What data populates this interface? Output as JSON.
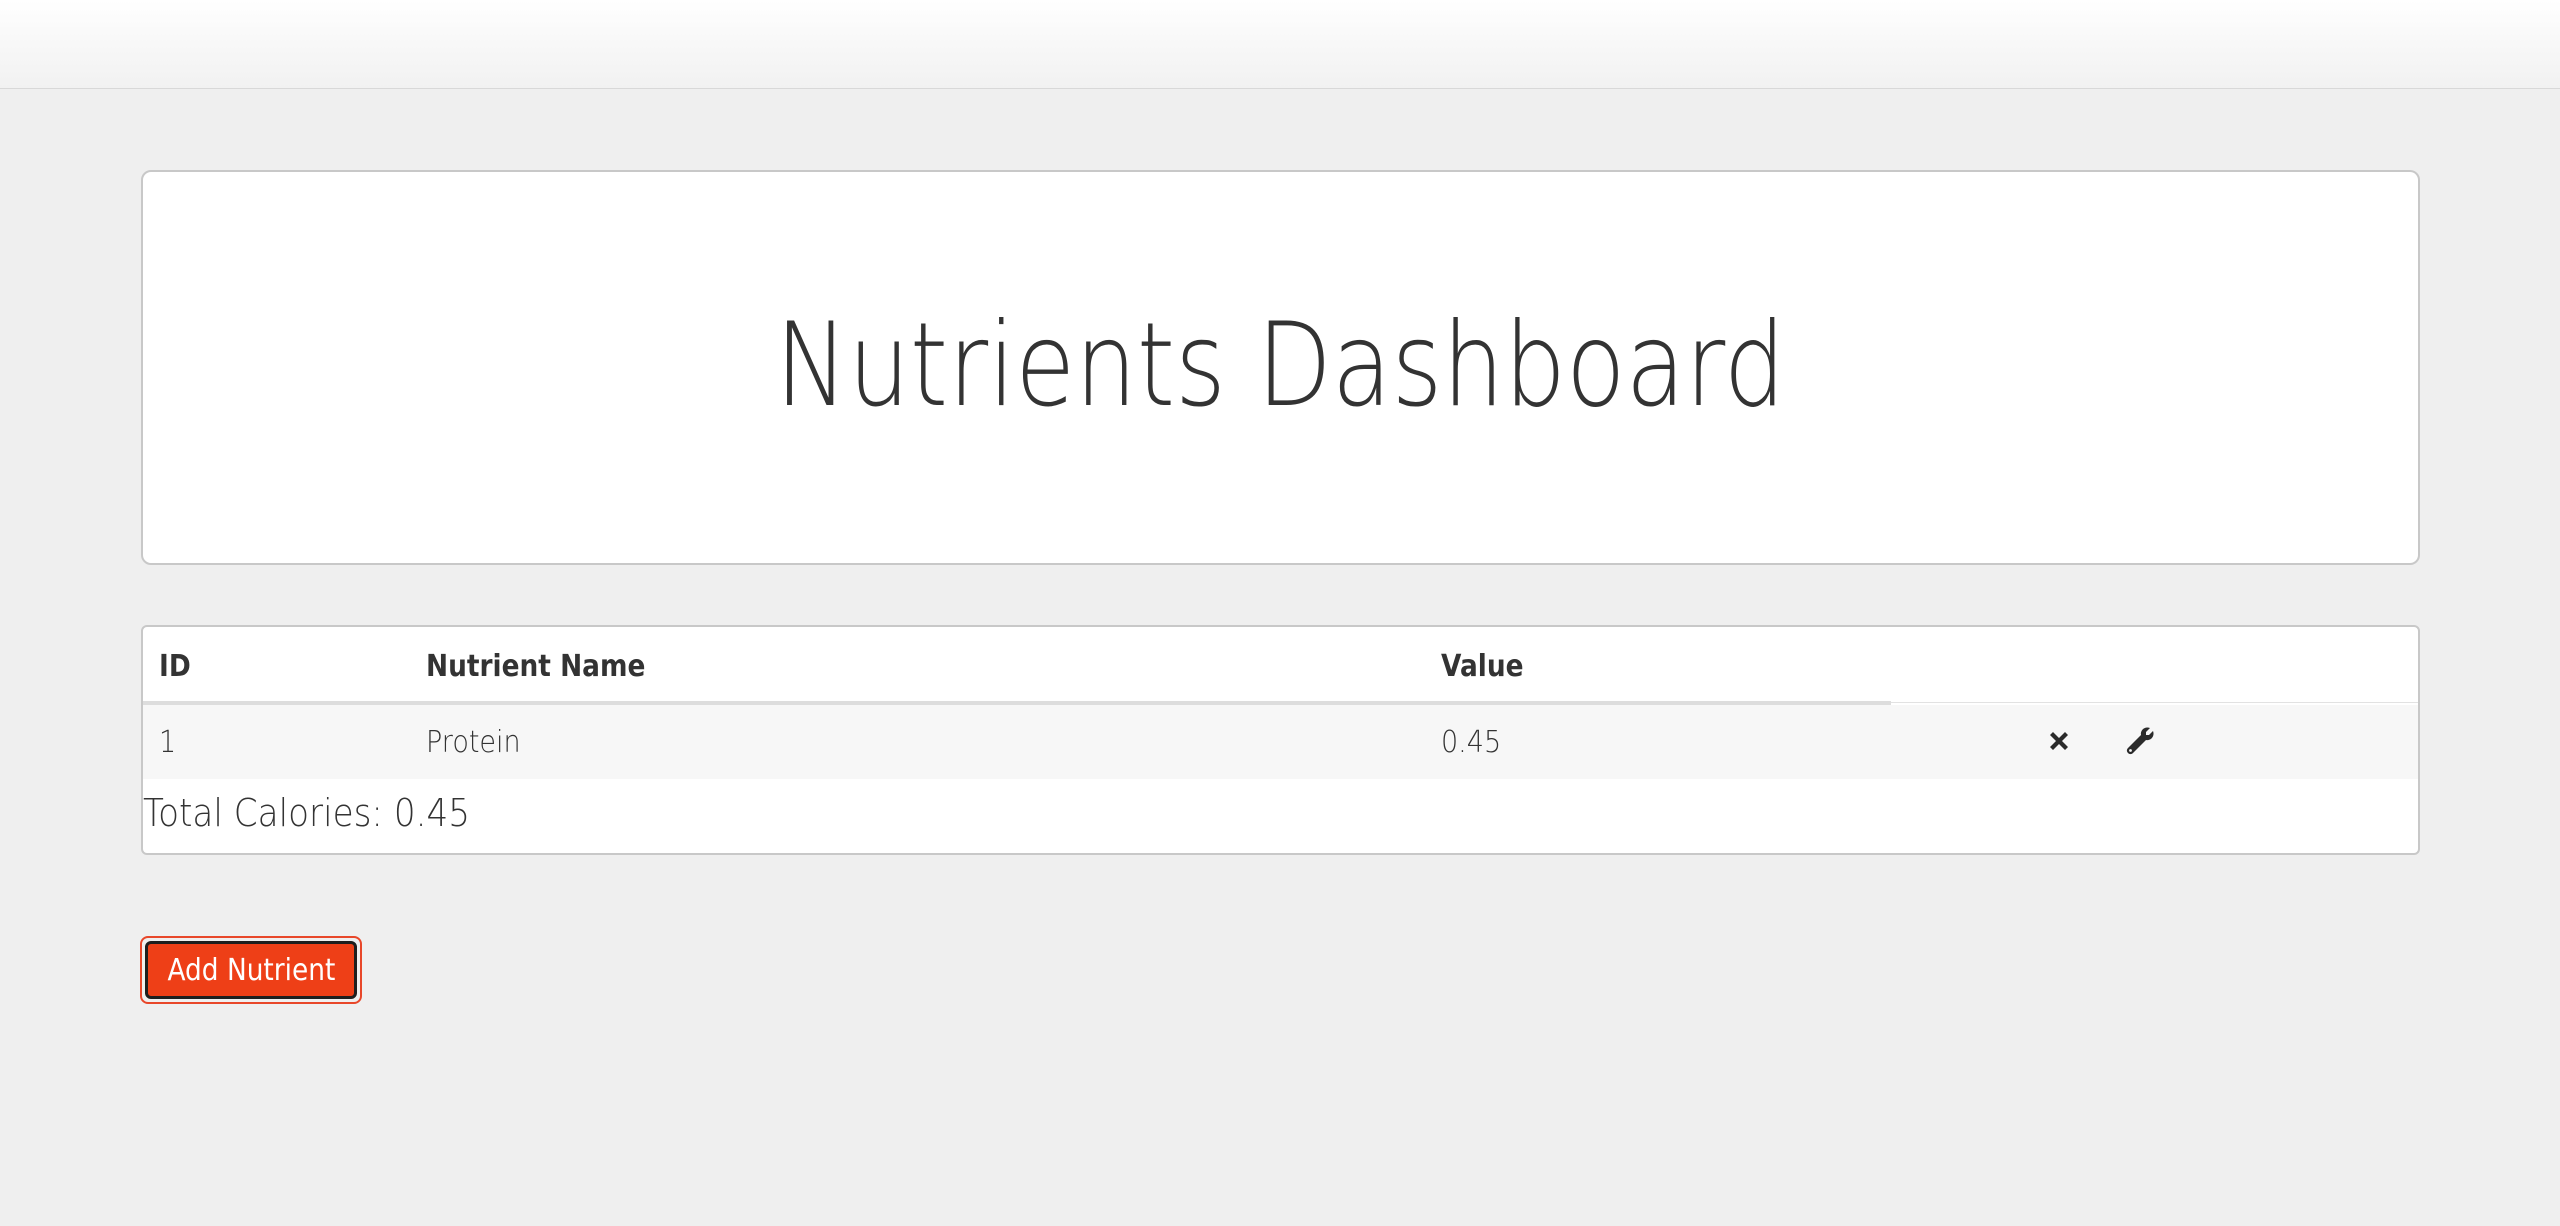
{
  "navbar": {},
  "header": {
    "title": "Nutrients Dashboard"
  },
  "table": {
    "columns": [
      "ID",
      "Nutrient Name",
      "Value"
    ],
    "rows": [
      {
        "id": "1",
        "name": "Protein",
        "value": "0.45",
        "actions": [
          "delete-icon",
          "wrench-icon"
        ]
      }
    ],
    "total_calories": "Total Calories: 0.45"
  },
  "actions": {
    "add_label": "Add Nutrient"
  },
  "colors": {
    "accent": "#ee3f17",
    "background": "#efefef",
    "text": "#333333"
  }
}
